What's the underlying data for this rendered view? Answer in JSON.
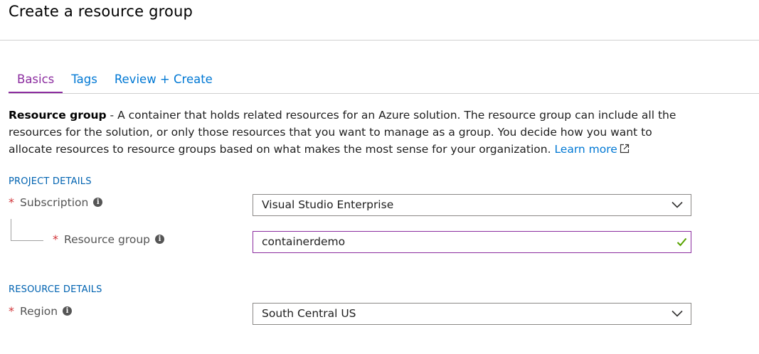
{
  "page": {
    "title": "Create a resource group"
  },
  "tabs": [
    {
      "label": "Basics",
      "active": true
    },
    {
      "label": "Tags",
      "active": false
    },
    {
      "label": "Review + Create",
      "active": false
    }
  ],
  "description": {
    "bold": "Resource group",
    "text": " - A container that holds related resources for an Azure solution. The resource group can include all the resources for the solution, or only those resources that you want to manage as a group. You decide how you want to allocate resources to resource groups based on what makes the most sense for your organization. ",
    "link": "Learn more"
  },
  "project_details": {
    "header": "PROJECT DETAILS",
    "subscription": {
      "label": "Subscription",
      "required_mark": "*",
      "value": "Visual Studio Enterprise"
    },
    "resource_group": {
      "label": "Resource group",
      "required_mark": "*",
      "value": "containerdemo"
    }
  },
  "resource_details": {
    "header": "RESOURCE DETAILS",
    "region": {
      "label": "Region",
      "required_mark": "*",
      "value": "South Central US"
    }
  },
  "icons": {
    "info": "info-icon",
    "external": "external-link-icon",
    "chevron": "chevron-down-icon",
    "check": "checkmark-icon"
  },
  "colors": {
    "accent": "#8b2c9f",
    "link": "#0078d4",
    "required": "#d13438",
    "valid": "#57a300"
  }
}
